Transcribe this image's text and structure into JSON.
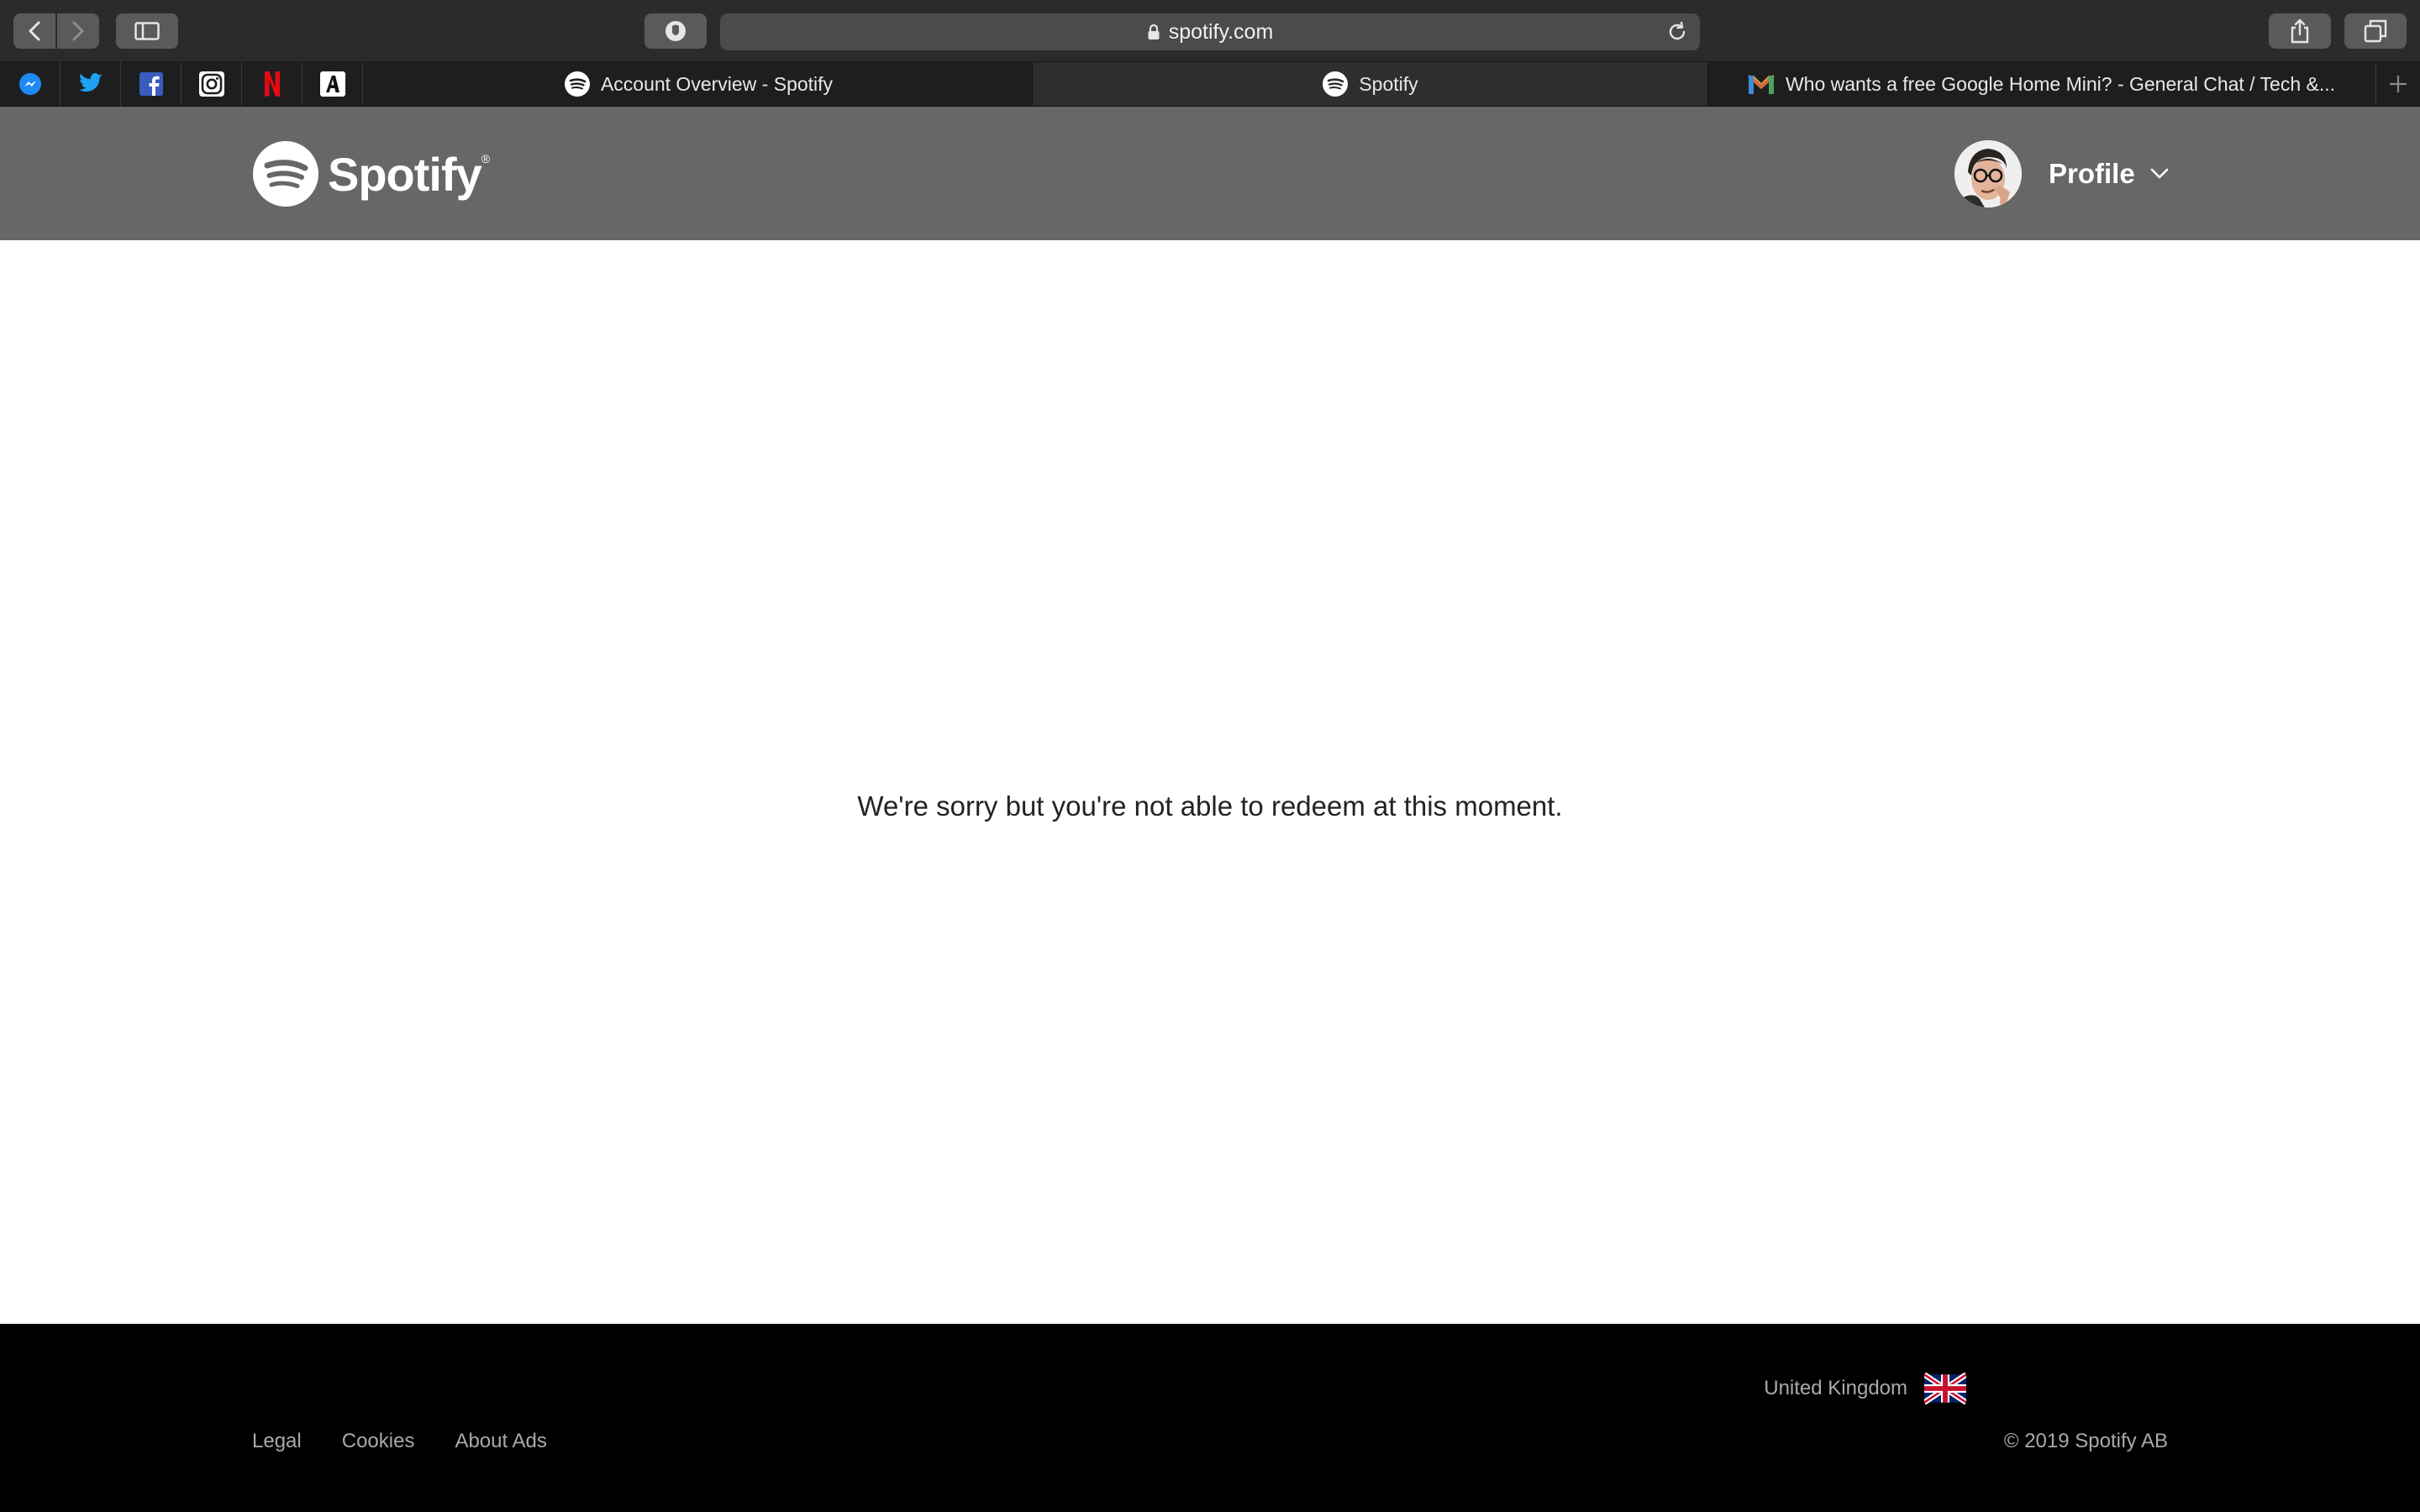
{
  "browser": {
    "url": "spotify.com",
    "tabs": [
      {
        "label": "Account Overview - Spotify",
        "icon": "spotify-icon",
        "active": false
      },
      {
        "label": "Spotify",
        "icon": "spotify-icon",
        "active": true
      },
      {
        "label": "Who wants a free Google Home Mini? - General Chat / Tech &...",
        "icon": "gmail-icon",
        "active": false
      }
    ],
    "favorites": [
      "messenger-icon",
      "twitter-icon",
      "facebook-icon",
      "instagram-icon",
      "netflix-icon",
      "app-a-icon"
    ]
  },
  "header": {
    "logo_text": "Spotify",
    "logo_reg": "®",
    "profile_label": "Profile"
  },
  "main": {
    "message": "We're sorry but you're not able to redeem at this moment."
  },
  "footer": {
    "links": [
      "Legal",
      "Cookies",
      "About Ads"
    ],
    "country": "United Kingdom",
    "copyright": "© 2019 Spotify AB"
  },
  "colors": {
    "header_bg": "#676767",
    "footer_bg": "#000000",
    "chrome_bg": "#2b2b2c"
  }
}
